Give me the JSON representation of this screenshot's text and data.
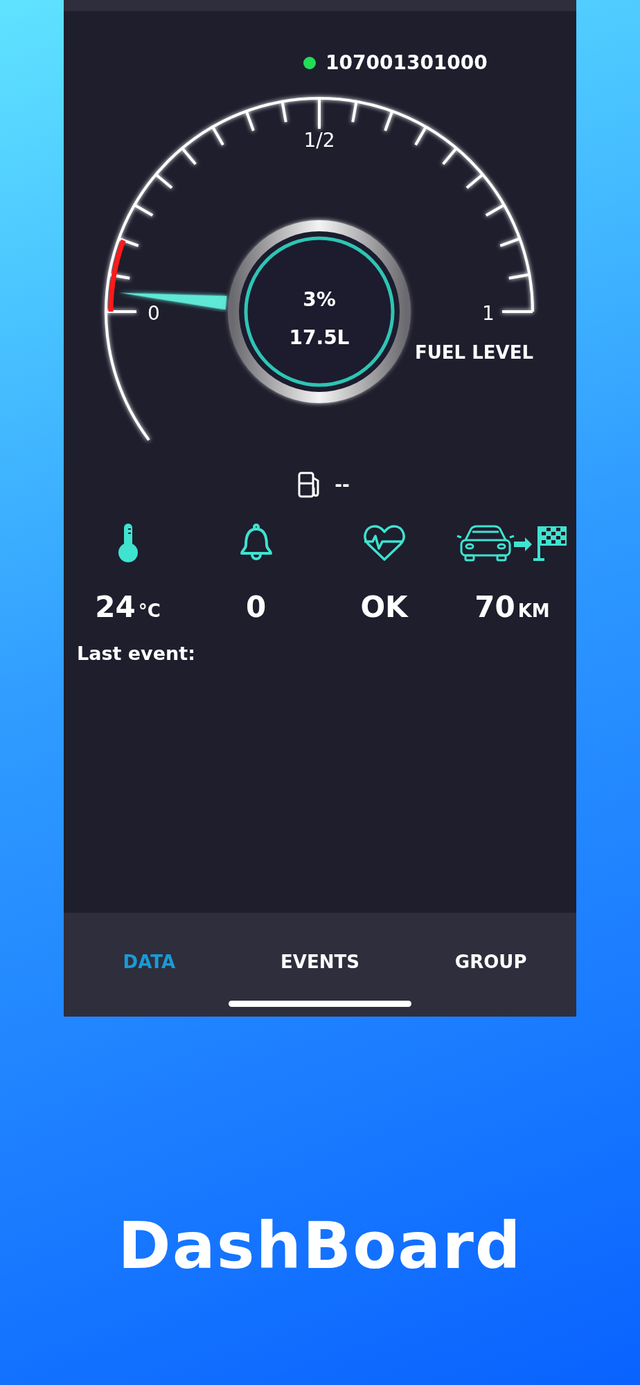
{
  "device": {
    "id": "107001301000",
    "online": true
  },
  "gauge": {
    "title": "FUEL LEVEL",
    "percent": "3%",
    "volume": "17.5L",
    "scale": [
      "0",
      "1/2",
      "1"
    ]
  },
  "fuel_station": {
    "value": "--"
  },
  "stats": [
    {
      "kind": "temperature",
      "value": "24",
      "unit": "°C"
    },
    {
      "kind": "alarms",
      "value": "0"
    },
    {
      "kind": "health",
      "value": "OK"
    },
    {
      "kind": "distance",
      "value": "70",
      "unit": "KM"
    }
  ],
  "last_event": {
    "label": "Last event:"
  },
  "tabs": [
    {
      "label": "DATA",
      "selected": true
    },
    {
      "label": "EVENTS",
      "selected": false
    },
    {
      "label": "GROUP",
      "selected": false
    }
  ],
  "caption": "DashBoard"
}
